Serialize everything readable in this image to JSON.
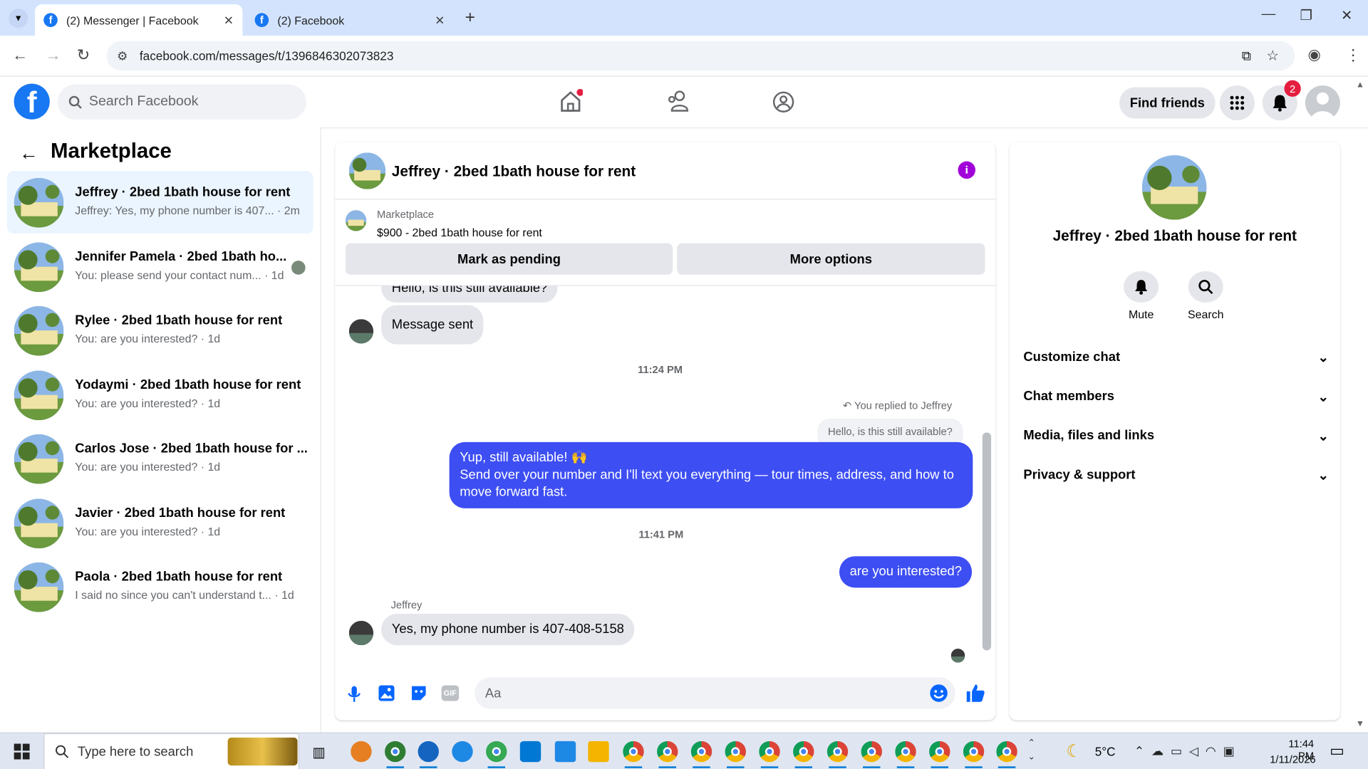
{
  "browser": {
    "tabs": [
      {
        "title": "(2) Messenger | Facebook",
        "active": true
      },
      {
        "title": "(2) Facebook",
        "active": false
      }
    ],
    "url": "facebook.com/messages/t/1396846302073823"
  },
  "fb_header": {
    "search_placeholder": "Search Facebook",
    "find_friends": "Find friends",
    "notification_count": "2",
    "logo_letter": "f"
  },
  "sidebar": {
    "title": "Marketplace",
    "conversations": [
      {
        "name": "Jeffrey · 2bed 1bath house for rent",
        "preview": "Jeffrey: Yes, my phone number is 407... · 2m",
        "selected": true
      },
      {
        "name": "Jennifer Pamela · 2bed 1bath ho...",
        "preview": "You: please send your contact num... · 1d",
        "selected": false
      },
      {
        "name": "Rylee · 2bed 1bath house for rent",
        "preview": "You: are you interested? · 1d",
        "selected": false
      },
      {
        "name": "Yodaymi · 2bed 1bath house for rent",
        "preview": "You: are you interested? · 1d",
        "selected": false
      },
      {
        "name": "Carlos Jose · 2bed 1bath house for ...",
        "preview": "You: are you interested? · 1d",
        "selected": false
      },
      {
        "name": "Javier · 2bed 1bath house for rent",
        "preview": "You: are you interested? · 1d",
        "selected": false
      },
      {
        "name": "Paola · 2bed 1bath house for rent",
        "preview": "I said no since you can't understand t... · 1d",
        "selected": false
      }
    ]
  },
  "chat": {
    "title": "Jeffrey · 2bed 1bath house for rent",
    "listing_source": "Marketplace",
    "listing_title": "$900 - 2bed 1bath house for rent",
    "mark_pending": "Mark as pending",
    "more_options": "More options",
    "messages": {
      "partial_top": "Hello, is this still available?",
      "msg_sent": "Message sent",
      "time1": "11:24 PM",
      "replied_to": "You replied to Jeffrey",
      "quoted": "Hello, is this still available?",
      "reply_line1": "Yup, still available! 🙌",
      "reply_line2": "Send over your number and I'll text you everything — tour times, address, and how to move forward fast.",
      "time2": "11:41 PM",
      "interested": "are you interested?",
      "sender": "Jeffrey",
      "phone_msg": "Yes, my phone number is 407-408-5158"
    },
    "composer_placeholder": "Aa",
    "gif_label": "GIF"
  },
  "details": {
    "title": "Jeffrey · 2bed 1bath house for rent",
    "mute": "Mute",
    "search": "Search",
    "sections": [
      "Customize chat",
      "Chat members",
      "Media, files and links",
      "Privacy & support"
    ]
  },
  "taskbar": {
    "search_placeholder": "Type here to search",
    "weather": "5°C",
    "time": "11:44 PM",
    "date": "1/11/2026"
  },
  "colors": {
    "fb_blue": "#1877f2",
    "bubble_outgoing": "#3d4ef3",
    "selected_row": "#ebf5ff",
    "tab_bar": "#d3e3fd"
  }
}
